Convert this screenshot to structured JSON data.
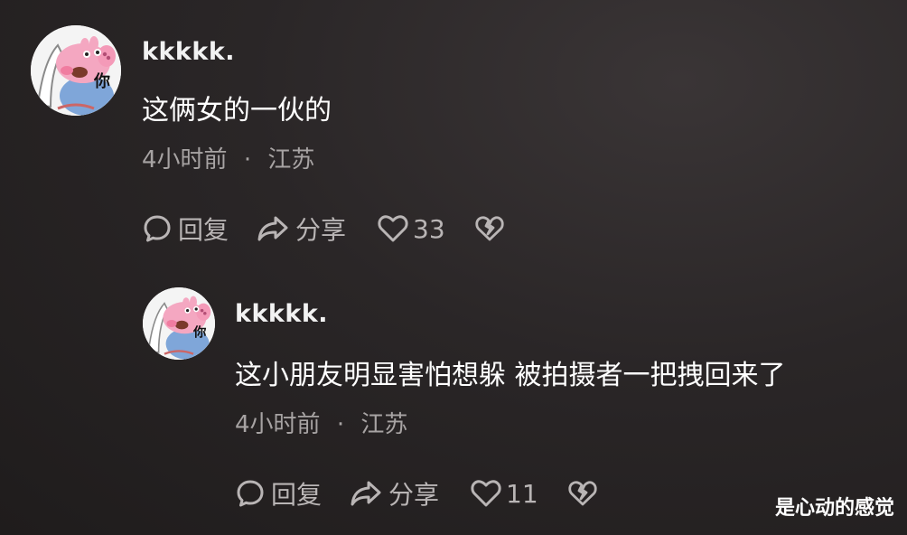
{
  "comments": [
    {
      "avatar_icon": "peppa-pig-avatar-icon",
      "avatar_text": "你",
      "username": "kkkkk.",
      "text": "这俩女的一伙的",
      "time": "4小时前",
      "separator": "·",
      "location": "江苏",
      "reply_label": "回复",
      "share_label": "分享",
      "likes": "33"
    },
    {
      "avatar_icon": "peppa-pig-avatar-icon",
      "avatar_text": "你",
      "username": "kkkkk.",
      "text": "这小朋友明显害怕想躲 被拍摄者一把拽回来了",
      "time": "4小时前",
      "separator": "·",
      "location": "江苏",
      "reply_label": "回复",
      "share_label": "分享",
      "likes": "11"
    }
  ],
  "icons": {
    "reply": "comment-bubble-icon",
    "share": "share-arrow-icon",
    "like": "heart-icon",
    "dislike": "broken-heart-icon"
  },
  "watermark": "是心动的感觉",
  "colors": {
    "background": "#2a2627",
    "text": "#ffffff",
    "meta": "#a7a3a3",
    "actions": "#b9b5b5",
    "avatar_pink": "#f4a7c1"
  }
}
